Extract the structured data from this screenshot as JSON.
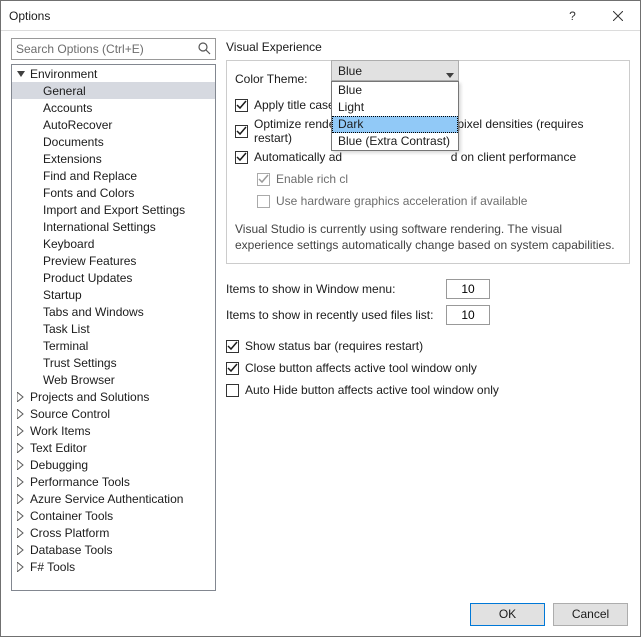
{
  "window": {
    "title": "Options"
  },
  "search": {
    "placeholder": "Search Options (Ctrl+E)"
  },
  "tree": {
    "env": "Environment",
    "env_children": [
      "General",
      "Accounts",
      "AutoRecover",
      "Documents",
      "Extensions",
      "Find and Replace",
      "Fonts and Colors",
      "Import and Export Settings",
      "International Settings",
      "Keyboard",
      "Preview Features",
      "Product Updates",
      "Startup",
      "Tabs and Windows",
      "Task List",
      "Terminal",
      "Trust Settings",
      "Web Browser"
    ],
    "top": [
      "Projects and Solutions",
      "Source Control",
      "Work Items",
      "Text Editor",
      "Debugging",
      "Performance Tools",
      "Azure Service Authentication",
      "Container Tools",
      "Cross Platform",
      "Database Tools",
      "F# Tools"
    ]
  },
  "right": {
    "visual_exp": "Visual Experience",
    "color_theme_label": "Color Theme:",
    "color_theme_value": "Blue",
    "theme_options": [
      "Blue",
      "Light",
      "Dark",
      "Blue (Extra Contrast)"
    ],
    "apply_title": "Apply title case styling to menu bar",
    "apply_title_frag": "Apply title case s",
    "optimize": "Optimize rendering for screens with different pixel densities (requires restart)",
    "optimize_pre": "Optimize renderi",
    "optimize_post": "t pixel densities (requires restart)",
    "auto_adjust": "Automatically adjust visual experience based on client performance",
    "auto_pre": "Automatically ad",
    "auto_post": "d on client performance",
    "enable_rich": "Enable rich client visual experience",
    "enable_rich_frag": "Enable rich cl",
    "use_hw": "Use hardware graphics acceleration if available",
    "info": "Visual Studio is currently using software rendering.  The visual experience settings automatically change based on system capabilities.",
    "items_window": "Items to show in Window menu:",
    "items_window_val": "10",
    "items_recent": "Items to show in recently used files list:",
    "items_recent_val": "10",
    "show_status": "Show status bar (requires restart)",
    "close_btn_affects": "Close button affects active tool window only",
    "autohide_affects": "Auto Hide button affects active tool window only"
  },
  "buttons": {
    "ok": "OK",
    "cancel": "Cancel"
  }
}
